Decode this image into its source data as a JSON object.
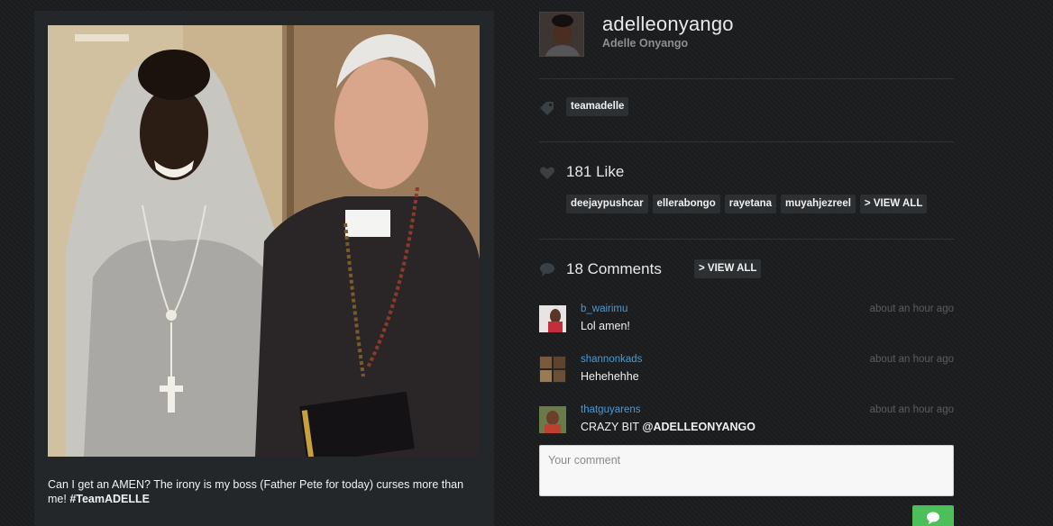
{
  "post": {
    "caption_text": "Can I get an AMEN? The irony is my boss (Father Pete for today) curses more than me! ",
    "caption_hashtag": "#TeamADELLE"
  },
  "profile": {
    "username": "adelleonyango",
    "full_name": "Adelle Onyango"
  },
  "tags": [
    "teamadelle"
  ],
  "likes": {
    "count_label": "181 Like",
    "users": [
      "deejaypushcar",
      "ellerabongo",
      "rayetana",
      "muyahjezreel"
    ],
    "view_all_label": "> VIEW ALL"
  },
  "comments": {
    "count_label": "18 Comments",
    "view_all_label": "> VIEW ALL",
    "items": [
      {
        "user": "b_wairimu",
        "time": "about an hour ago",
        "text": "Lol amen!"
      },
      {
        "user": "shannonkads",
        "time": "about an hour ago",
        "text": "Hehehehhe"
      },
      {
        "user": "thatguyarens",
        "time": "about an hour ago",
        "text_prefix": "CRAZY BIT ",
        "mention": "@ADELLEONYANGO"
      }
    ],
    "input_placeholder": "Your comment"
  },
  "icons": {
    "tag": "tag-icon",
    "likes": "heart-icon",
    "comments": "speech-bubble-icon",
    "send": "chat-send-icon"
  },
  "colors": {
    "background": "#1b1d1f",
    "link": "#4a9bd6",
    "send_button": "#4cbf5a"
  }
}
